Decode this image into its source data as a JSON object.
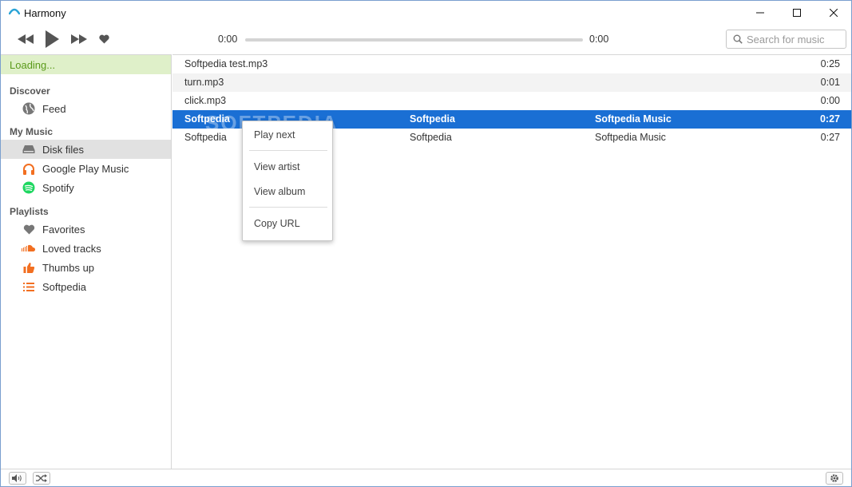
{
  "window": {
    "title": "Harmony",
    "min_icon": "minimize-icon",
    "max_icon": "maximize-icon",
    "close_icon": "close-icon"
  },
  "toolbar": {
    "elapsed": "0:00",
    "total": "0:00",
    "progress": 0,
    "search_placeholder": "Search for music"
  },
  "sidebar": {
    "status": "Loading...",
    "discover_heading": "Discover",
    "discover_items": [
      {
        "label": "Feed",
        "icon": "globe-icon"
      }
    ],
    "mymusic_heading": "My Music",
    "mymusic_items": [
      {
        "label": "Disk files",
        "icon": "disk-icon",
        "active": true
      },
      {
        "label": "Google Play Music",
        "icon": "headphones-icon"
      },
      {
        "label": "Spotify",
        "icon": "spotify-icon"
      }
    ],
    "playlists_heading": "Playlists",
    "playlist_items": [
      {
        "label": "Favorites",
        "icon": "heart-icon"
      },
      {
        "label": "Loved tracks",
        "icon": "soundcloud-icon"
      },
      {
        "label": "Thumbs up",
        "icon": "thumbs-up-icon"
      },
      {
        "label": "Softpedia",
        "icon": "list-icon"
      }
    ]
  },
  "tracks": [
    {
      "title": "Softpedia test.mp3",
      "artist": "",
      "album": "",
      "duration": "0:25"
    },
    {
      "title": "turn.mp3",
      "artist": "",
      "album": "",
      "duration": "0:01"
    },
    {
      "title": "click.mp3",
      "artist": "",
      "album": "",
      "duration": "0:00"
    },
    {
      "title": "Softpedia",
      "artist": "Softpedia",
      "album": "Softpedia Music",
      "duration": "0:27",
      "selected": true
    },
    {
      "title": "Softpedia",
      "artist": "Softpedia",
      "album": "Softpedia Music",
      "duration": "0:27"
    }
  ],
  "context_menu": {
    "play_next": "Play next",
    "view_artist": "View artist",
    "view_album": "View album",
    "copy_url": "Copy URL"
  },
  "watermark": "SOFTPEDIA",
  "colors": {
    "selection": "#1a6fd4",
    "loading_bg": "#dff0c9",
    "loading_text": "#5a9a1a",
    "accent_orange": "#f26f21",
    "spotify_green": "#1ed760"
  }
}
